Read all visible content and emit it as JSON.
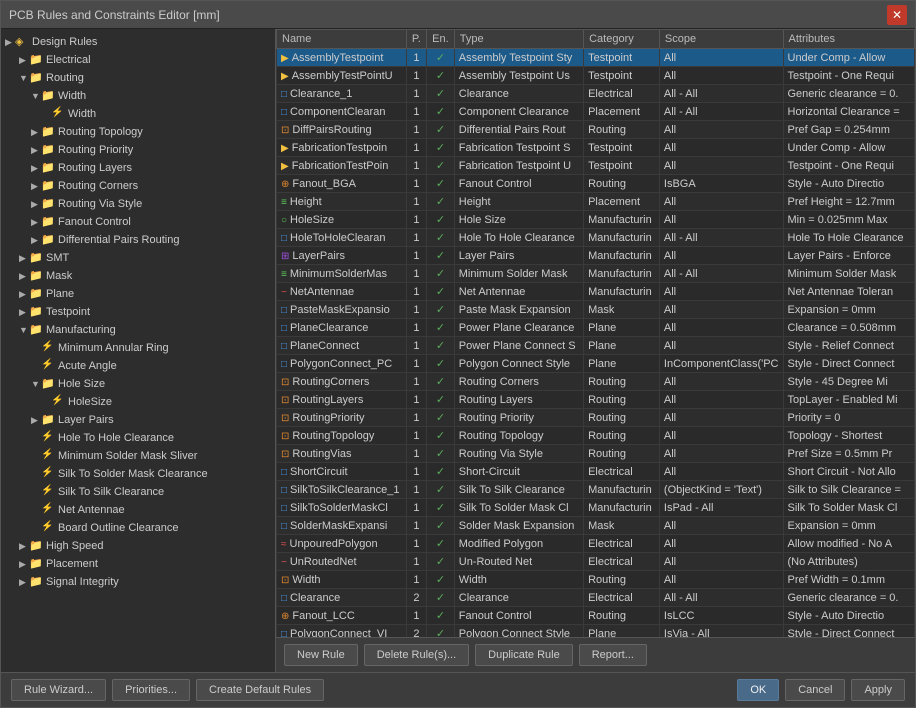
{
  "window": {
    "title": "PCB Rules and Constraints Editor [mm]",
    "close_label": "✕"
  },
  "tree": {
    "items": [
      {
        "id": "design-rules",
        "label": "Design Rules",
        "indent": 0,
        "arrow": "▶",
        "type": "folder",
        "selected": false
      },
      {
        "id": "electrical",
        "label": "Electrical",
        "indent": 1,
        "arrow": "▶",
        "type": "folder",
        "selected": false
      },
      {
        "id": "routing",
        "label": "Routing",
        "indent": 1,
        "arrow": "▼",
        "type": "folder",
        "selected": false
      },
      {
        "id": "width",
        "label": "Width",
        "indent": 2,
        "arrow": "▼",
        "type": "folder",
        "selected": false
      },
      {
        "id": "width-rule",
        "label": "Width",
        "indent": 3,
        "arrow": "",
        "type": "rule",
        "selected": false
      },
      {
        "id": "routing-topology",
        "label": "Routing Topology",
        "indent": 2,
        "arrow": "▶",
        "type": "folder",
        "selected": false
      },
      {
        "id": "routing-priority",
        "label": "Routing Priority",
        "indent": 2,
        "arrow": "▶",
        "type": "folder",
        "selected": false
      },
      {
        "id": "routing-layers",
        "label": "Routing Layers",
        "indent": 2,
        "arrow": "▶",
        "type": "folder",
        "selected": false
      },
      {
        "id": "routing-corners",
        "label": "Routing Corners",
        "indent": 2,
        "arrow": "▶",
        "type": "folder",
        "selected": false
      },
      {
        "id": "routing-via-style",
        "label": "Routing Via Style",
        "indent": 2,
        "arrow": "▶",
        "type": "folder",
        "selected": false
      },
      {
        "id": "fanout-control",
        "label": "Fanout Control",
        "indent": 2,
        "arrow": "▶",
        "type": "folder",
        "selected": false
      },
      {
        "id": "diff-pairs-routing",
        "label": "Differential Pairs Routing",
        "indent": 2,
        "arrow": "▶",
        "type": "folder",
        "selected": false
      },
      {
        "id": "smt",
        "label": "SMT",
        "indent": 1,
        "arrow": "▶",
        "type": "folder",
        "selected": false
      },
      {
        "id": "mask",
        "label": "Mask",
        "indent": 1,
        "arrow": "▶",
        "type": "folder",
        "selected": false
      },
      {
        "id": "plane",
        "label": "Plane",
        "indent": 1,
        "arrow": "▶",
        "type": "folder",
        "selected": false
      },
      {
        "id": "testpoint",
        "label": "Testpoint",
        "indent": 1,
        "arrow": "▶",
        "type": "folder",
        "selected": false
      },
      {
        "id": "manufacturing",
        "label": "Manufacturing",
        "indent": 1,
        "arrow": "▼",
        "type": "folder",
        "selected": false
      },
      {
        "id": "min-annular-ring",
        "label": "Minimum Annular Ring",
        "indent": 2,
        "arrow": "",
        "type": "rule",
        "selected": false
      },
      {
        "id": "acute-angle",
        "label": "Acute Angle",
        "indent": 2,
        "arrow": "",
        "type": "rule",
        "selected": false
      },
      {
        "id": "hole-size",
        "label": "Hole Size",
        "indent": 2,
        "arrow": "▼",
        "type": "folder",
        "selected": false
      },
      {
        "id": "hole-size-rule",
        "label": "HoleSize",
        "indent": 3,
        "arrow": "",
        "type": "rule",
        "selected": false
      },
      {
        "id": "layer-pairs",
        "label": "Layer Pairs",
        "indent": 2,
        "arrow": "▶",
        "type": "folder",
        "selected": false
      },
      {
        "id": "hole-to-hole",
        "label": "Hole To Hole Clearance",
        "indent": 2,
        "arrow": "",
        "type": "rule",
        "selected": false
      },
      {
        "id": "min-solder-mask",
        "label": "Minimum Solder Mask Sliver",
        "indent": 2,
        "arrow": "",
        "type": "rule",
        "selected": false
      },
      {
        "id": "silk-solder-mask",
        "label": "Silk To Solder Mask Clearance",
        "indent": 2,
        "arrow": "",
        "type": "rule",
        "selected": false
      },
      {
        "id": "silk-to-silk",
        "label": "Silk To Silk Clearance",
        "indent": 2,
        "arrow": "",
        "type": "rule",
        "selected": false
      },
      {
        "id": "net-antennae",
        "label": "Net Antennae",
        "indent": 2,
        "arrow": "",
        "type": "rule",
        "selected": false
      },
      {
        "id": "board-outline",
        "label": "Board Outline Clearance",
        "indent": 2,
        "arrow": "",
        "type": "rule",
        "selected": false
      },
      {
        "id": "high-speed",
        "label": "High Speed",
        "indent": 1,
        "arrow": "▶",
        "type": "folder",
        "selected": false
      },
      {
        "id": "placement",
        "label": "Placement",
        "indent": 1,
        "arrow": "▶",
        "type": "folder",
        "selected": false
      },
      {
        "id": "signal-integrity",
        "label": "Signal Integrity",
        "indent": 1,
        "arrow": "▶",
        "type": "folder",
        "selected": false
      }
    ]
  },
  "table": {
    "columns": [
      "Name",
      "P.",
      "En.",
      "Type",
      "Category",
      "Scope",
      "Attributes"
    ],
    "rows": [
      {
        "icon": "▶",
        "icon_color": "dot-yellow",
        "name": "AssemblyTestpoint",
        "p": "1",
        "en": true,
        "type": "Assembly Testpoint Sty",
        "category": "Testpoint",
        "scope": "All",
        "attrs": "Under Comp - Allow",
        "selected": true
      },
      {
        "icon": "▶",
        "icon_color": "dot-yellow",
        "name": "AssemblyTestPointU",
        "p": "1",
        "en": true,
        "type": "Assembly Testpoint Us",
        "category": "Testpoint",
        "scope": "All",
        "attrs": "Testpoint - One Requi"
      },
      {
        "icon": "□",
        "icon_color": "dot-blue",
        "name": "Clearance_1",
        "p": "1",
        "en": true,
        "type": "Clearance",
        "category": "Electrical",
        "scope": "All  -  All",
        "attrs": "Generic clearance = 0."
      },
      {
        "icon": "□",
        "icon_color": "dot-blue",
        "name": "ComponentClearan",
        "p": "1",
        "en": true,
        "type": "Component Clearance",
        "category": "Placement",
        "scope": "All  -  All",
        "attrs": "Horizontal Clearance ="
      },
      {
        "icon": "⊡",
        "icon_color": "dot-orange",
        "name": "DiffPairsRouting",
        "p": "1",
        "en": true,
        "type": "Differential Pairs Rout",
        "category": "Routing",
        "scope": "All",
        "attrs": "Pref Gap = 0.254mm"
      },
      {
        "icon": "▶",
        "icon_color": "dot-yellow",
        "name": "FabricationTestpoin",
        "p": "1",
        "en": true,
        "type": "Fabrication Testpoint S",
        "category": "Testpoint",
        "scope": "All",
        "attrs": "Under Comp - Allow"
      },
      {
        "icon": "▶",
        "icon_color": "dot-yellow",
        "name": "FabricationTestPoin",
        "p": "1",
        "en": true,
        "type": "Fabrication Testpoint U",
        "category": "Testpoint",
        "scope": "All",
        "attrs": "Testpoint - One Requi"
      },
      {
        "icon": "⊕",
        "icon_color": "dot-orange",
        "name": "Fanout_BGA",
        "p": "1",
        "en": true,
        "type": "Fanout Control",
        "category": "Routing",
        "scope": "IsBGA",
        "attrs": "Style - Auto  Directio"
      },
      {
        "icon": "≡",
        "icon_color": "dot-green",
        "name": "Height",
        "p": "1",
        "en": true,
        "type": "Height",
        "category": "Placement",
        "scope": "All",
        "attrs": "Pref Height = 12.7mm"
      },
      {
        "icon": "○",
        "icon_color": "dot-green",
        "name": "HoleSize",
        "p": "1",
        "en": true,
        "type": "Hole Size",
        "category": "Manufacturin",
        "scope": "All",
        "attrs": "Min = 0.025mm  Max"
      },
      {
        "icon": "□",
        "icon_color": "dot-blue",
        "name": "HoleToHoleClearan",
        "p": "1",
        "en": true,
        "type": "Hole To Hole Clearance",
        "category": "Manufacturin",
        "scope": "All  -  All",
        "attrs": "Hole To Hole Clearance"
      },
      {
        "icon": "⊞",
        "icon_color": "dot-purple",
        "name": "LayerPairs",
        "p": "1",
        "en": true,
        "type": "Layer Pairs",
        "category": "Manufacturin",
        "scope": "All",
        "attrs": "Layer Pairs - Enforce"
      },
      {
        "icon": "≡",
        "icon_color": "dot-green",
        "name": "MinimumSolderMas",
        "p": "1",
        "en": true,
        "type": "Minimum Solder Mask",
        "category": "Manufacturin",
        "scope": "All  -  All",
        "attrs": "Minimum Solder Mask"
      },
      {
        "icon": "~",
        "icon_color": "dot-red",
        "name": "NetAntennae",
        "p": "1",
        "en": true,
        "type": "Net Antennae",
        "category": "Manufacturin",
        "scope": "All",
        "attrs": "Net Antennae Toleran"
      },
      {
        "icon": "□",
        "icon_color": "dot-blue",
        "name": "PasteMaskExpansio",
        "p": "1",
        "en": true,
        "type": "Paste Mask Expansion",
        "category": "Mask",
        "scope": "All",
        "attrs": "Expansion = 0mm"
      },
      {
        "icon": "□",
        "icon_color": "dot-blue",
        "name": "PlaneClearance",
        "p": "1",
        "en": true,
        "type": "Power Plane Clearance",
        "category": "Plane",
        "scope": "All",
        "attrs": "Clearance = 0.508mm"
      },
      {
        "icon": "□",
        "icon_color": "dot-blue",
        "name": "PlaneConnect",
        "p": "1",
        "en": true,
        "type": "Power Plane Connect S",
        "category": "Plane",
        "scope": "All",
        "attrs": "Style - Relief Connect"
      },
      {
        "icon": "□",
        "icon_color": "dot-blue",
        "name": "PolygonConnect_PC",
        "p": "1",
        "en": true,
        "type": "Polygon Connect Style",
        "category": "Plane",
        "scope": "InComponentClass('PC",
        "attrs": "Style - Direct Connect"
      },
      {
        "icon": "⊡",
        "icon_color": "dot-orange",
        "name": "RoutingCorners",
        "p": "1",
        "en": true,
        "type": "Routing Corners",
        "category": "Routing",
        "scope": "All",
        "attrs": "Style - 45 Degree  Mi"
      },
      {
        "icon": "⊡",
        "icon_color": "dot-orange",
        "name": "RoutingLayers",
        "p": "1",
        "en": true,
        "type": "Routing Layers",
        "category": "Routing",
        "scope": "All",
        "attrs": "TopLayer - Enabled Mi"
      },
      {
        "icon": "⊡",
        "icon_color": "dot-orange",
        "name": "RoutingPriority",
        "p": "1",
        "en": true,
        "type": "Routing Priority",
        "category": "Routing",
        "scope": "All",
        "attrs": "Priority = 0"
      },
      {
        "icon": "⊡",
        "icon_color": "dot-orange",
        "name": "RoutingTopology",
        "p": "1",
        "en": true,
        "type": "Routing Topology",
        "category": "Routing",
        "scope": "All",
        "attrs": "Topology - Shortest"
      },
      {
        "icon": "⊡",
        "icon_color": "dot-orange",
        "name": "RoutingVias",
        "p": "1",
        "en": true,
        "type": "Routing Via Style",
        "category": "Routing",
        "scope": "All",
        "attrs": "Pref Size = 0.5mm  Pr"
      },
      {
        "icon": "□",
        "icon_color": "dot-blue",
        "name": "ShortCircuit",
        "p": "1",
        "en": true,
        "type": "Short-Circuit",
        "category": "Electrical",
        "scope": "All",
        "attrs": "Short Circuit - Not Allo"
      },
      {
        "icon": "□",
        "icon_color": "dot-blue",
        "name": "SilkToSilkClearance_1",
        "p": "1",
        "en": true,
        "type": "Silk To Silk Clearance",
        "category": "Manufacturin",
        "scope": "(ObjectKind = 'Text')",
        "attrs": "Silk to Silk Clearance ="
      },
      {
        "icon": "□",
        "icon_color": "dot-blue",
        "name": "SilkToSolderMaskCl",
        "p": "1",
        "en": true,
        "type": "Silk To Solder Mask Cl",
        "category": "Manufacturin",
        "scope": "IsPad  -  All",
        "attrs": "Silk To Solder Mask Cl"
      },
      {
        "icon": "□",
        "icon_color": "dot-blue",
        "name": "SolderMaskExpansi",
        "p": "1",
        "en": true,
        "type": "Solder Mask Expansion",
        "category": "Mask",
        "scope": "All",
        "attrs": "Expansion = 0mm"
      },
      {
        "icon": "≈",
        "icon_color": "dot-red",
        "name": "UnpouredPolygon",
        "p": "1",
        "en": true,
        "type": "Modified Polygon",
        "category": "Electrical",
        "scope": "All",
        "attrs": "Allow modified - No A"
      },
      {
        "icon": "~",
        "icon_color": "dot-red",
        "name": "UnRoutedNet",
        "p": "1",
        "en": true,
        "type": "Un-Routed Net",
        "category": "Electrical",
        "scope": "All",
        "attrs": "(No Attributes)"
      },
      {
        "icon": "⊡",
        "icon_color": "dot-orange",
        "name": "Width",
        "p": "1",
        "en": true,
        "type": "Width",
        "category": "Routing",
        "scope": "All",
        "attrs": "Pref Width = 0.1mm"
      },
      {
        "icon": "□",
        "icon_color": "dot-blue",
        "name": "Clearance",
        "p": "2",
        "en": true,
        "type": "Clearance",
        "category": "Electrical",
        "scope": "All  -  All",
        "attrs": "Generic clearance = 0."
      },
      {
        "icon": "⊕",
        "icon_color": "dot-orange",
        "name": "Fanout_LCC",
        "p": "1",
        "en": true,
        "type": "Fanout Control",
        "category": "Routing",
        "scope": "IsLCC",
        "attrs": "Style - Auto  Directio"
      },
      {
        "icon": "□",
        "icon_color": "dot-blue",
        "name": "PolygonConnect_VI",
        "p": "2",
        "en": true,
        "type": "Polygon Connect Style",
        "category": "Plane",
        "scope": "IsVia  -  All",
        "attrs": "Style - Direct Connect"
      }
    ]
  },
  "table_buttons": {
    "new_rule": "New Rule",
    "delete_rule": "Delete Rule(s)...",
    "duplicate_rule": "Duplicate Rule",
    "report": "Report..."
  },
  "footer": {
    "rule_wizard": "Rule Wizard...",
    "priorities": "Priorities...",
    "create_defaults": "Create Default Rules",
    "ok": "OK",
    "cancel": "Cancel",
    "apply": "Apply"
  }
}
